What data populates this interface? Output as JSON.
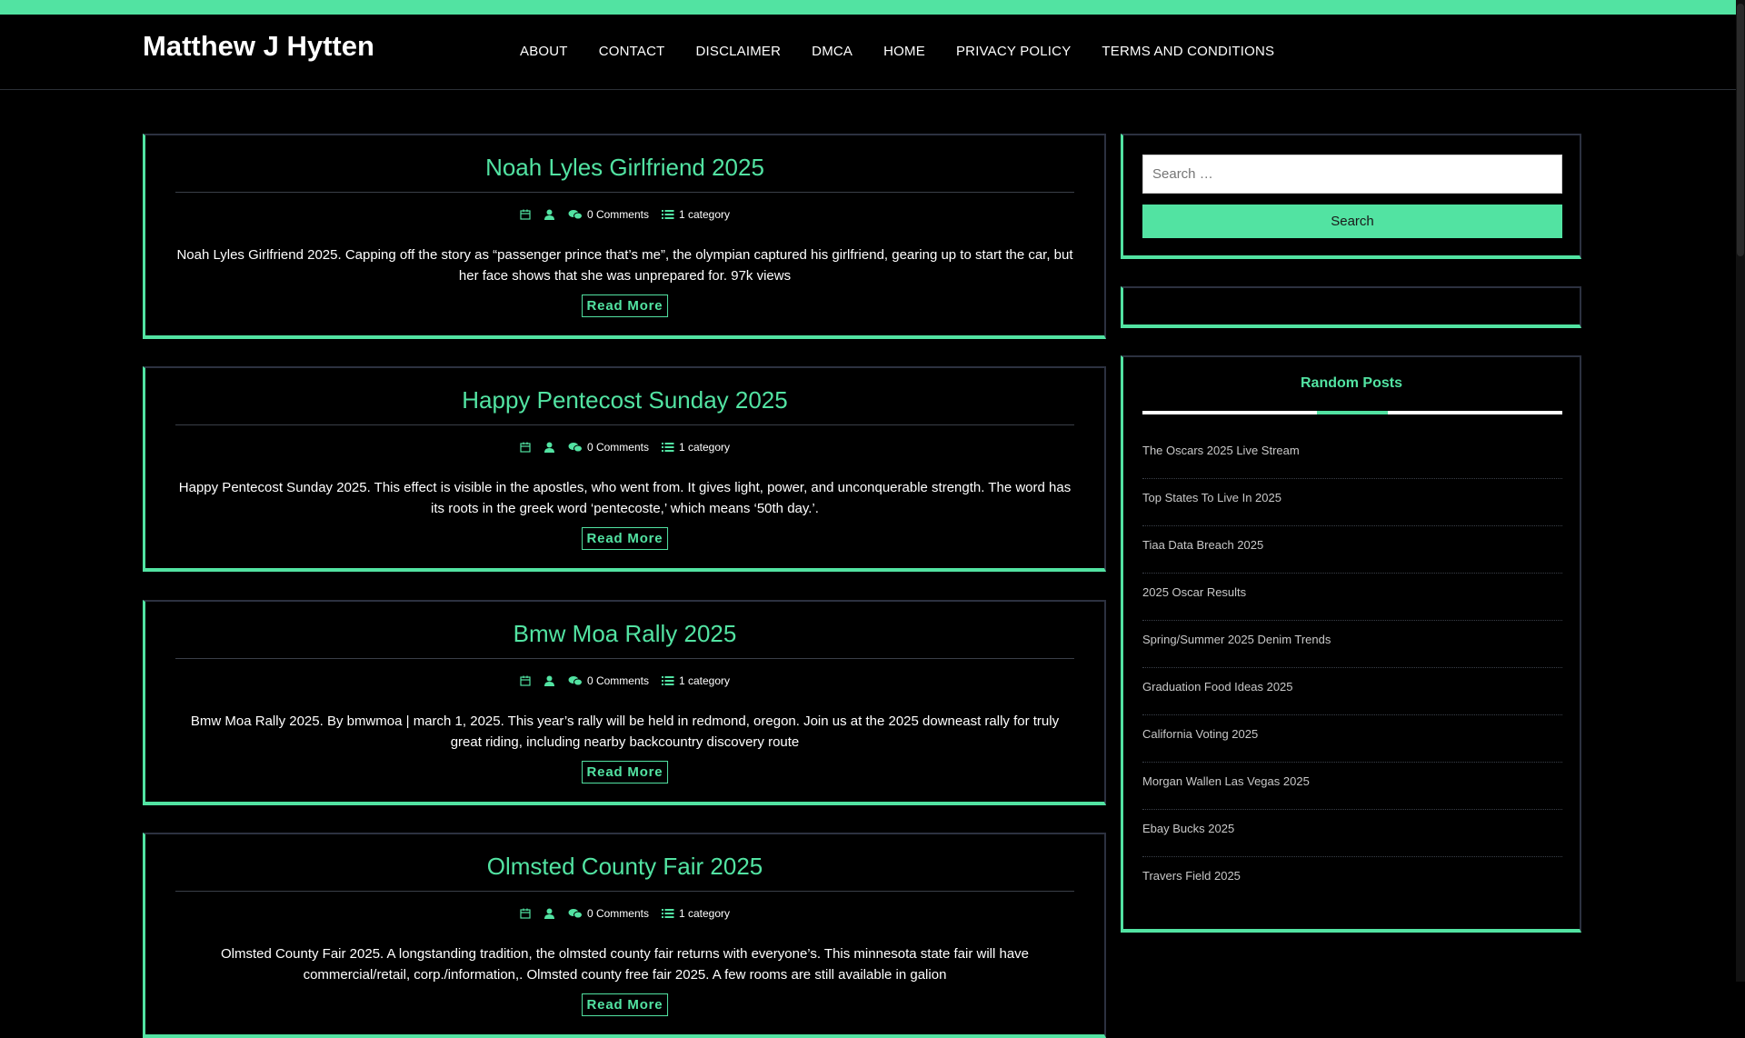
{
  "site": {
    "title": "Matthew J Hytten"
  },
  "nav": [
    "ABOUT",
    "CONTACT",
    "DISCLAIMER",
    "DMCA",
    "HOME",
    "PRIVACY POLICY",
    "TERMS AND CONDITIONS"
  ],
  "posts": [
    {
      "title": "Noah Lyles Girlfriend 2025",
      "comments": "0 Comments",
      "category": "1 category",
      "excerpt": "Noah Lyles Girlfriend 2025. Capping off the story as “passenger prince that’s me”, the olympian captured his girlfriend, gearing up to start the car, but her face shows that she was unprepared for. 97k views",
      "read_more": "Read More"
    },
    {
      "title": "Happy Pentecost Sunday 2025",
      "comments": "0 Comments",
      "category": "1 category",
      "excerpt": "Happy Pentecost Sunday 2025. This effect is visible in the apostles, who went from. It gives light, power, and unconquerable strength. The word has its roots in the greek word ‘pentecoste,’ which means ‘50th day.’.",
      "read_more": "Read More"
    },
    {
      "title": "Bmw Moa Rally 2025",
      "comments": "0 Comments",
      "category": "1 category",
      "excerpt": "Bmw Moa Rally 2025. By bmwmoa | march 1, 2025. This year’s rally will be held in redmond, oregon. Join us at the 2025 downeast rally for truly great riding, including nearby backcountry discovery route",
      "read_more": "Read More"
    },
    {
      "title": "Olmsted County Fair 2025",
      "comments": "0 Comments",
      "category": "1 category",
      "excerpt": "Olmsted County Fair 2025. A longstanding tradition, the olmsted county fair returns with everyone’s. This minnesota state fair will have commercial/retail, corp./information,. Olmsted county free fair 2025. A few rooms are still available in galion",
      "read_more": "Read More"
    }
  ],
  "search": {
    "placeholder": "Search …",
    "button": "Search"
  },
  "random_posts": {
    "title": "Random Posts",
    "items": [
      "The Oscars 2025 Live Stream",
      "Top States To Live In 2025",
      "Tiaa Data Breach 2025",
      "2025 Oscar Results",
      "Spring/Summer 2025 Denim Trends",
      "Graduation Food Ideas 2025",
      "California Voting 2025",
      "Morgan Wallen Las Vegas 2025",
      "Ebay Bucks 2025",
      "Travers Field 2025"
    ]
  },
  "colors": {
    "accent": "#52e3a2",
    "background": "#000000",
    "text": "#ffffff"
  },
  "icons": {
    "date": "calendar-icon",
    "author": "user-icon",
    "comments": "comments-icon",
    "category": "list-icon"
  }
}
